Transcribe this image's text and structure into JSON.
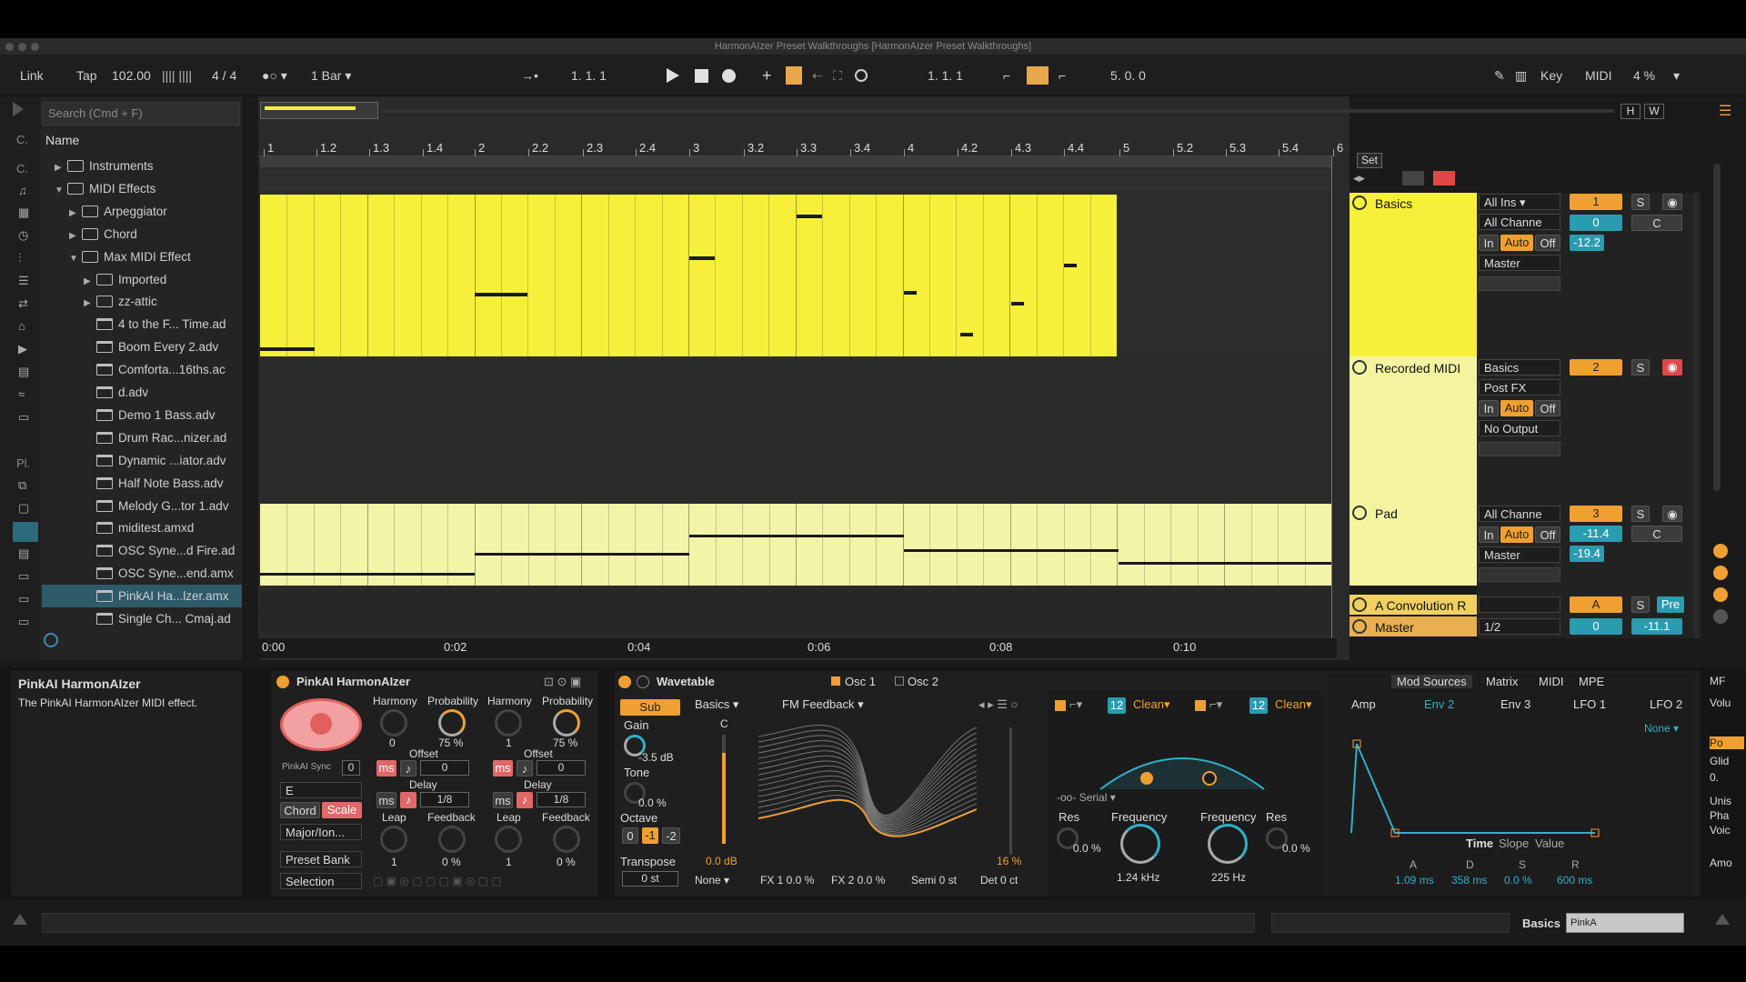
{
  "window": {
    "title": "HarmonAIzer Preset Walkthroughs  [HarmonAIzer Preset Walkthroughs]"
  },
  "transport": {
    "link": "Link",
    "tap": "Tap",
    "tempo": "102.00",
    "signature": "4 / 4",
    "quantize": "1 Bar",
    "position": "1.   1.   1",
    "loop_start": "1.   1.   1",
    "loop_length": "5.   0.   0",
    "key": "Key",
    "midi": "MIDI",
    "cpu": "4 %"
  },
  "browser": {
    "search_placeholder": "Search (Cmd + F)",
    "column_header": "Name",
    "rail_labels": [
      "C.",
      "C.",
      "Pl."
    ],
    "items": [
      {
        "label": "Instruments",
        "kind": "folder",
        "indent": 0,
        "arrow": "▶"
      },
      {
        "label": "MIDI Effects",
        "kind": "folder",
        "indent": 0,
        "arrow": "▼"
      },
      {
        "label": "Arpeggiator",
        "kind": "folder",
        "indent": 1,
        "arrow": "▶"
      },
      {
        "label": "Chord",
        "kind": "folder",
        "indent": 1,
        "arrow": "▶"
      },
      {
        "label": "Max MIDI Effect",
        "kind": "folder",
        "indent": 1,
        "arrow": "▼"
      },
      {
        "label": "Imported",
        "kind": "folder",
        "indent": 2,
        "arrow": "▶"
      },
      {
        "label": "zz-attic",
        "kind": "folder",
        "indent": 2,
        "arrow": "▶"
      },
      {
        "label": "4 to the F... Time.ad",
        "kind": "file",
        "indent": 2,
        "arrow": ""
      },
      {
        "label": "Boom Every 2.adv",
        "kind": "file",
        "indent": 2,
        "arrow": ""
      },
      {
        "label": "Comforta...16ths.ac",
        "kind": "file",
        "indent": 2,
        "arrow": ""
      },
      {
        "label": "d.adv",
        "kind": "file",
        "indent": 2,
        "arrow": ""
      },
      {
        "label": "Demo 1 Bass.adv",
        "kind": "file",
        "indent": 2,
        "arrow": ""
      },
      {
        "label": "Drum Rac...nizer.ad",
        "kind": "file",
        "indent": 2,
        "arrow": ""
      },
      {
        "label": "Dynamic ...iator.adv",
        "kind": "file",
        "indent": 2,
        "arrow": ""
      },
      {
        "label": "Half Note Bass.adv",
        "kind": "file",
        "indent": 2,
        "arrow": ""
      },
      {
        "label": "Melody G...tor 1.adv",
        "kind": "file",
        "indent": 2,
        "arrow": ""
      },
      {
        "label": "miditest.amxd",
        "kind": "file",
        "indent": 2,
        "arrow": ""
      },
      {
        "label": "OSC Syne...d Fire.ad",
        "kind": "file",
        "indent": 2,
        "arrow": ""
      },
      {
        "label": "OSC Syne...end.amx",
        "kind": "file",
        "indent": 2,
        "arrow": ""
      },
      {
        "label": "PinkAI Ha...lzer.amx",
        "kind": "file",
        "indent": 2,
        "arrow": "",
        "selected": true
      },
      {
        "label": "Single Ch... Cmaj.ad",
        "kind": "file",
        "indent": 2,
        "arrow": ""
      }
    ]
  },
  "ruler": {
    "labels": [
      "1",
      "1.2",
      "1.3",
      "1.4",
      "2",
      "2.2",
      "2.3",
      "2.4",
      "3",
      "3.2",
      "3.3",
      "3.4",
      "4",
      "4.2",
      "4.3",
      "4.4",
      "5",
      "5.2",
      "5.3",
      "5.4",
      "6"
    ],
    "set": "Set"
  },
  "time_axis": [
    "0:00",
    "0:02",
    "0:04",
    "0:06",
    "0:08",
    "0:10"
  ],
  "tracks": {
    "basics": {
      "name": "Basics",
      "input": "All Ins",
      "channel": "All Channe",
      "mon_in": "In",
      "mon_auto": "Auto",
      "mon_off": "Off",
      "output": "Master",
      "number": "1",
      "solo": "S",
      "pan": "0",
      "pan_label": "C",
      "volume": "-12.2"
    },
    "recorded": {
      "name": "Recorded MIDI",
      "input": "Basics",
      "channel": "Post FX",
      "mon_in": "In",
      "mon_auto": "Auto",
      "mon_off": "Off",
      "output": "No Output",
      "number": "2",
      "solo": "S"
    },
    "pad": {
      "name": "Pad",
      "channel": "All Channe",
      "mon_in": "In",
      "mon_auto": "Auto",
      "mon_off": "Off",
      "output": "Master",
      "number": "3",
      "solo": "S",
      "send": "-11.4",
      "pan_label": "C",
      "volume": "-19.4"
    },
    "convolution": {
      "name": "A Convolution R",
      "letter": "A",
      "solo": "S",
      "pre": "Pre"
    },
    "master": {
      "name": "Master",
      "division": "1/2",
      "pan": "0",
      "volume": "-11.1"
    }
  },
  "info": {
    "title": "PinkAI HarmonAIzer",
    "description": "The PinkAI HarmonAIzer MIDI effect."
  },
  "harmonaizer": {
    "title": "PinkAI HarmonAIzer",
    "col1": {
      "harmony_label": "Harmony",
      "probability_label": "Probability",
      "harmony": "0",
      "probability": "75 %",
      "offset_label": "Offset",
      "offset": "0",
      "delay_label": "Delay",
      "delay": "1/8",
      "leap_label": "Leap",
      "feedback_label": "Feedback",
      "leap": "1",
      "feedback": "0 %"
    },
    "col2": {
      "harmony_label": "Harmony",
      "probability_label": "Probability",
      "harmony": "1",
      "probability": "75 %",
      "offset_label": "Offset",
      "offset": "0",
      "delay_label": "Delay",
      "delay": "1/8",
      "leap_label": "Leap",
      "feedback_label": "Feedback",
      "leap": "1",
      "feedback": "0 %"
    },
    "sync_label": "PinkAI Sync",
    "sync_value": "0",
    "ms": "ms",
    "key": "E",
    "chord": "Chord",
    "scale": "Scale",
    "mode": "Major/Ion...",
    "preset_bank": "Preset Bank",
    "selection": "Selection"
  },
  "wavetable": {
    "title": "Wavetable",
    "osc1": "Osc 1",
    "osc2": "Osc 2",
    "sub": "Sub",
    "gain_label": "Gain",
    "gain": "-3.5 dB",
    "tone_label": "Tone",
    "tone": "0.0 %",
    "octave_label": "Octave",
    "octaves": [
      "0",
      "-1",
      "-2"
    ],
    "transpose_label": "Transpose",
    "transpose": "0 st",
    "wave_cat": "Basics",
    "wave_name": "FM Feedback",
    "note": "C",
    "level_db": "0.0 dB",
    "level_pct": "16 %",
    "fx_mode": "None",
    "fx1": "FX 1  0.0 %",
    "fx2": "FX 2  0.0 %",
    "semi": "Semi  0 st",
    "det": "Det  0 ct"
  },
  "filters": {
    "f1_slope": "12",
    "f1_type": "Clean",
    "f2_slope": "12",
    "f2_type": "Clean",
    "routing": "Serial",
    "res1_label": "Res",
    "res1": "0.0 %",
    "freq1_label": "Frequency",
    "freq1": "1.24 kHz",
    "freq2_label": "Frequency",
    "freq2": "225 Hz",
    "res2_label": "Res",
    "res2": "0.0 %"
  },
  "mod": {
    "tabs": [
      "Mod Sources",
      "Matrix",
      "MIDI",
      "MPE"
    ],
    "env_tabs": [
      "Amp",
      "Env 2",
      "Env 3",
      "LFO 1",
      "LFO 2"
    ],
    "none": "None",
    "time": "Time",
    "slope": "Slope",
    "value": "Value",
    "adsr_labels": [
      "A",
      "D",
      "S",
      "R"
    ],
    "adsr_values": [
      "1.09 ms",
      "358 ms",
      "0.0 %",
      "600 ms"
    ]
  },
  "right_edge": {
    "labels": [
      "MF",
      "Volu",
      "Po",
      "Glid",
      "0.",
      "Unis",
      "Pha",
      "Voic",
      "Amo"
    ]
  },
  "status": {
    "track": "Basics",
    "device": "PinkA"
  },
  "colors": {
    "clip_yellow": "#f6f03a",
    "pad_yellow": "#f2f5a8",
    "accent_orange": "#f0a030",
    "accent_cyan": "#2a9cb0"
  }
}
